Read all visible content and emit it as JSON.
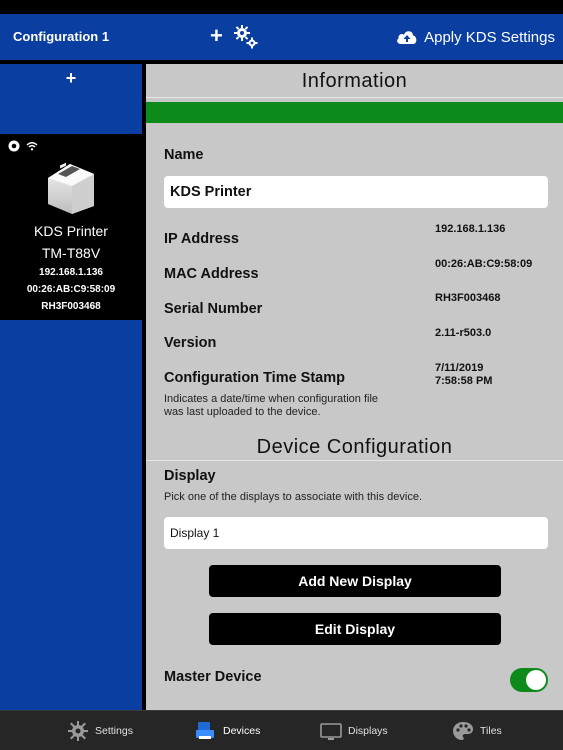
{
  "nav": {
    "title": "Configuration 1",
    "add_label": "+",
    "apply_label": "Apply KDS Settings"
  },
  "sidebar": {
    "add_label": "+",
    "device": {
      "name": "KDS Printer",
      "model": "TM-T88V",
      "ip": "192.168.1.136",
      "mac": "00:26:AB:C9:58:09",
      "serial": "RH3F003468"
    }
  },
  "info": {
    "title": "Information",
    "name_label": "Name",
    "name_value": "KDS Printer",
    "ip_label": "IP Address",
    "ip_value": "192.168.1.136",
    "mac_label": "MAC Address",
    "mac_value": "00:26:AB:C9:58:09",
    "serial_label": "Serial Number",
    "serial_value": "RH3F003468",
    "version_label": "Version",
    "version_value": "2.11-r503.0",
    "timestamp_label": "Configuration Time Stamp",
    "timestamp_date": "7/11/2019",
    "timestamp_time": "7:58:58 PM",
    "timestamp_desc_1": "Indicates a date/time when configuration file",
    "timestamp_desc_2": "was last uploaded to the device."
  },
  "device_config": {
    "title": "Device Configuration",
    "display_label": "Display",
    "display_desc": "Pick one of the displays to associate with this device.",
    "display_value": "Display 1",
    "add_display_label": "Add New Display",
    "edit_display_label": "Edit Display",
    "master_label": "Master Device",
    "master_on": true
  },
  "tabs": [
    {
      "label": "Settings",
      "icon": "gear-icon"
    },
    {
      "label": "Devices",
      "icon": "devices-icon",
      "active": true
    },
    {
      "label": "Displays",
      "icon": "monitor-icon"
    },
    {
      "label": "Tiles",
      "icon": "palette-icon"
    }
  ],
  "colors": {
    "brand_blue": "#0a3ea1",
    "accent_green": "#0e8a1a"
  }
}
